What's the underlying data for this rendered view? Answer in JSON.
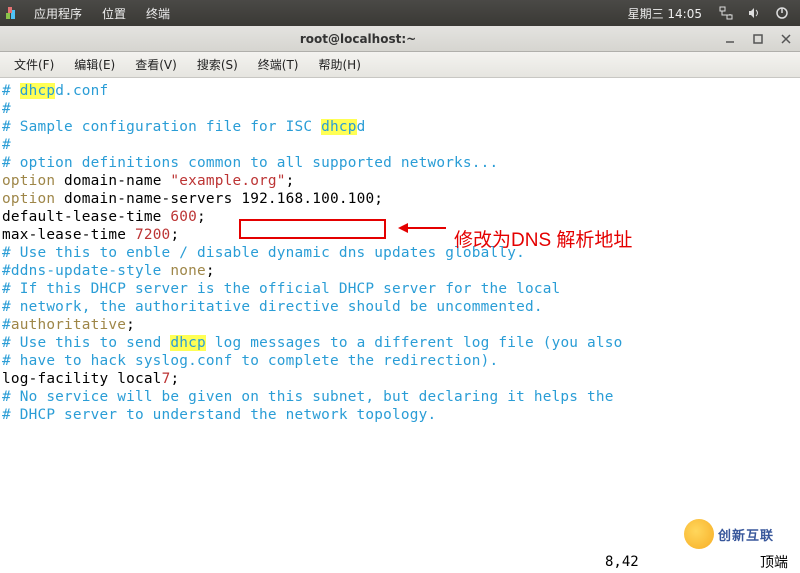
{
  "panel": {
    "apps_label": "应用程序",
    "places_label": "位置",
    "terminal_label": "终端",
    "clock": "星期三 14:05"
  },
  "window": {
    "title": "root@localhost:~"
  },
  "menubar": {
    "file": "文件(F)",
    "edit": "编辑(E)",
    "view": "查看(V)",
    "search": "搜索(S)",
    "terminal": "终端(T)",
    "help": "帮助(H)"
  },
  "content": {
    "l1_hash": "#",
    "l1_dhcp": "dhcp",
    "l1_tail": "d.conf",
    "l2": "#",
    "l3_a": "# Sample configuration file for ISC ",
    "l3_dhcp": "dhcp",
    "l3_b": "d",
    "l4": "#",
    "l5": "",
    "l6": "# option definitions common to all supported networks...",
    "l7_a": "option",
    "l7_b": " domain-name ",
    "l7_c": "\"example.org\"",
    "l7_d": ";",
    "l8_a": "option",
    "l8_b": " domain-name-servers ",
    "l8_box": "192.168.100.100;",
    "l9": "",
    "l10_a": "default-lease-time ",
    "l10_b": "600",
    "l10_c": ";",
    "l11_a": "max-lease-time ",
    "l11_b": "7200",
    "l11_c": ";",
    "l12": "",
    "l13": "# Use this to enble / disable dynamic dns updates globally.",
    "l14_a": "#ddns-update-style ",
    "l14_b": "none",
    "l14_c": ";",
    "l15": "",
    "l16": "# If this DHCP server is the official DHCP server for the local",
    "l17": "# network, the authoritative directive should be uncommented.",
    "l18_a": "#",
    "l18_b": "authoritative",
    "l18_c": ";",
    "l19": "",
    "l20_a": "# Use this to send ",
    "l20_dhcp": "dhcp",
    "l20_b": " log messages to a different log file (you also",
    "l21": "# have to hack syslog.conf to complete the redirection).",
    "l22_a": "log-facility local",
    "l22_b": "7",
    "l22_c": ";",
    "l23": "",
    "l24": "# No service will be given on this subnet, but declaring it helps the",
    "l25": "# DHCP server to understand the network topology."
  },
  "annotation": {
    "text": "修改为DNS 解析地址"
  },
  "status": {
    "position": "8,42",
    "mode": "顶端"
  },
  "watermark": {
    "text": "创新互联"
  }
}
